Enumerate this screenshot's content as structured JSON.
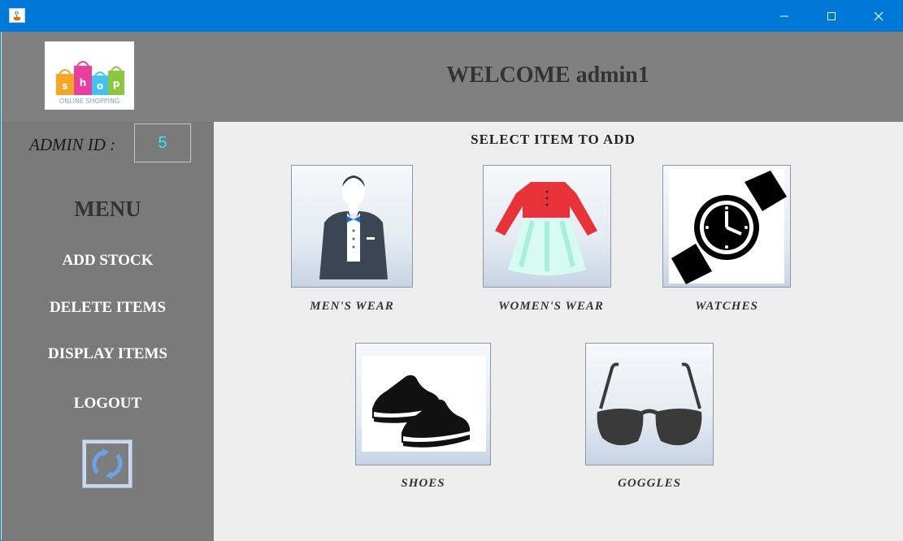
{
  "window": {
    "title": "",
    "controls": [
      "minimize",
      "maximize",
      "close"
    ]
  },
  "header": {
    "welcome": "WELCOME admin1",
    "logo": {
      "letters": [
        "s",
        "h",
        "o",
        "p"
      ],
      "tagline": "ONLINE SHOPPING"
    }
  },
  "sidebar": {
    "admin_id_label": "ADMIN ID :",
    "admin_id_value": "5",
    "menu_title": "MENU",
    "items": [
      {
        "label": "ADD STOCK"
      },
      {
        "label": "DELETE ITEMS"
      },
      {
        "label": "DISPLAY ITEMS"
      },
      {
        "label": "LOGOUT"
      }
    ],
    "refresh_icon": "refresh-icon"
  },
  "main": {
    "title": "SELECT ITEM TO ADD",
    "categories": [
      {
        "label": "MEN'S WEAR",
        "icon": "mens-wear-icon"
      },
      {
        "label": "WOMEN'S WEAR",
        "icon": "womens-wear-icon"
      },
      {
        "label": "WATCHES",
        "icon": "watch-icon"
      },
      {
        "label": "SHOES",
        "icon": "shoes-icon"
      },
      {
        "label": "GOGGLES",
        "icon": "goggles-icon"
      }
    ]
  },
  "colors": {
    "titlebar": "#0078d7",
    "header": "#808080",
    "sidebar": "#7a7a7a",
    "main_bg": "#eeeeee",
    "admin_id_text": "#33e5ff"
  }
}
